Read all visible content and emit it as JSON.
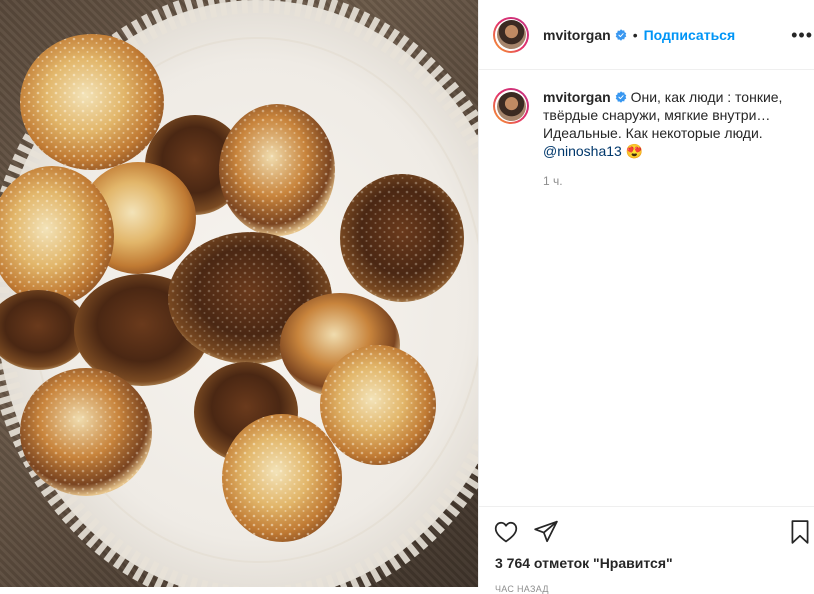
{
  "header": {
    "username": "mvitorgan",
    "separator": "•",
    "follow_label": "Подписаться",
    "more_icon": "more-horizontal-icon"
  },
  "caption": {
    "username": "mvitorgan",
    "line1": "Они, как люди : тонкие,",
    "line2": "твёрдые снаружи, мягкие внутри…",
    "line3": "Идеальные. Как некоторые люди.",
    "mention": "@ninosha13",
    "emoji": "😍",
    "time": "1 ч."
  },
  "actions": {
    "like_icon": "heart-icon",
    "share_icon": "paper-plane-icon",
    "save_icon": "bookmark-icon",
    "likes_text": "3 764 отметок \"Нравится\"",
    "time_ago": "ЧАС НАЗАД"
  },
  "colors": {
    "follow": "#0095f6",
    "mention": "#00376b",
    "muted": "#8e8e8e",
    "verified": "#3897f0",
    "plate": "#f4f1ec"
  }
}
